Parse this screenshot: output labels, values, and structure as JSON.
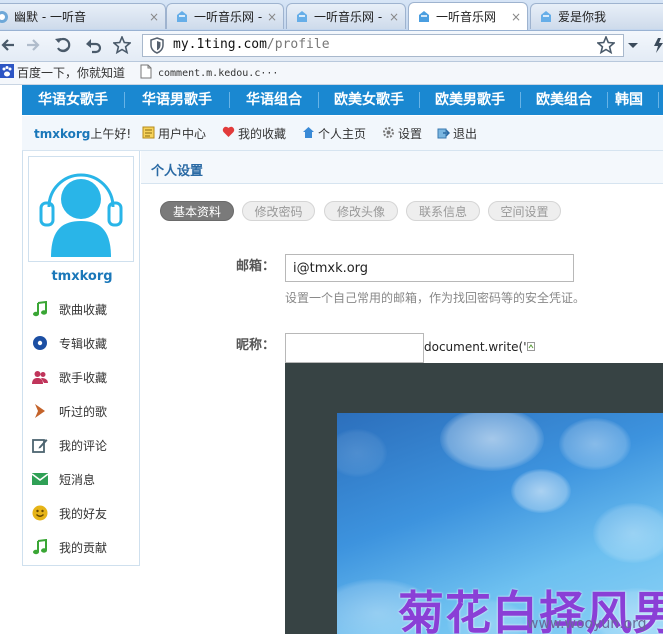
{
  "browser": {
    "tabs": [
      {
        "title": "幽默 - 一听音",
        "active": false
      },
      {
        "title": "一听音乐网 -",
        "active": false
      },
      {
        "title": "一听音乐网 -",
        "active": false
      },
      {
        "title": "一听音乐网",
        "active": true
      },
      {
        "title": "爱是你我",
        "active": false
      }
    ],
    "address": {
      "host": "my.1ting.com",
      "path": "/profile"
    },
    "bookmarks": [
      {
        "label": "百度一下，你就知道",
        "icon": "baidu-paw-icon"
      },
      {
        "label": "comment.m.kedou.c···",
        "icon": "page-icon"
      }
    ]
  },
  "site": {
    "nav": [
      "华语女歌手",
      "华语男歌手",
      "华语组合",
      "欧美女歌手",
      "欧美男歌手",
      "欧美组合",
      "韩国"
    ],
    "user": {
      "name": "tmxkorg",
      "greeting": "上午好!",
      "links": [
        {
          "label": "用户中心",
          "icon": "user-center-icon"
        },
        {
          "label": "我的收藏",
          "icon": "heart-icon"
        },
        {
          "label": "个人主页",
          "icon": "home-icon"
        },
        {
          "label": "设置",
          "icon": "gear-icon"
        },
        {
          "label": "退出",
          "icon": "logout-icon"
        }
      ]
    },
    "sidebar": {
      "username": "tmxkorg",
      "items": [
        {
          "label": "歌曲收藏",
          "icon": "music-note-icon",
          "color": "#3aa635"
        },
        {
          "label": "专辑收藏",
          "icon": "disc-icon",
          "color": "#1c4fa3"
        },
        {
          "label": "歌手收藏",
          "icon": "people-icon",
          "color": "#c0355b"
        },
        {
          "label": "听过的歌",
          "icon": "play-chevron-icon",
          "color": "#c4632a"
        },
        {
          "label": "我的评论",
          "icon": "edit-icon",
          "color": "#4d6470"
        },
        {
          "label": "短消息",
          "icon": "envelope-icon",
          "color": "#2fa055"
        },
        {
          "label": "我的好友",
          "icon": "smiley-icon",
          "color": "#e6b417"
        },
        {
          "label": "我的贡献",
          "icon": "music-note-icon",
          "color": "#3aa635"
        }
      ]
    },
    "settings": {
      "title": "个人设置",
      "tabs": [
        "基本资料",
        "修改密码",
        "修改头像",
        "联系信息",
        "空间设置"
      ],
      "email": {
        "label": "邮箱：",
        "value": "i@tmxk.org",
        "hint": "设置一个自己常用的邮箱，作为找回密码等的安全凭证。"
      },
      "nickname": {
        "label": "昵称：",
        "value": "",
        "injected": "document.write('"
      }
    }
  },
  "watermark": {
    "text": "菊花白择风男",
    "site": "www.wooyun.org"
  },
  "colors": {
    "nav_blue": "#1a88d1",
    "accent_link": "#1a77b9",
    "watermark": "#8a3fd6"
  }
}
